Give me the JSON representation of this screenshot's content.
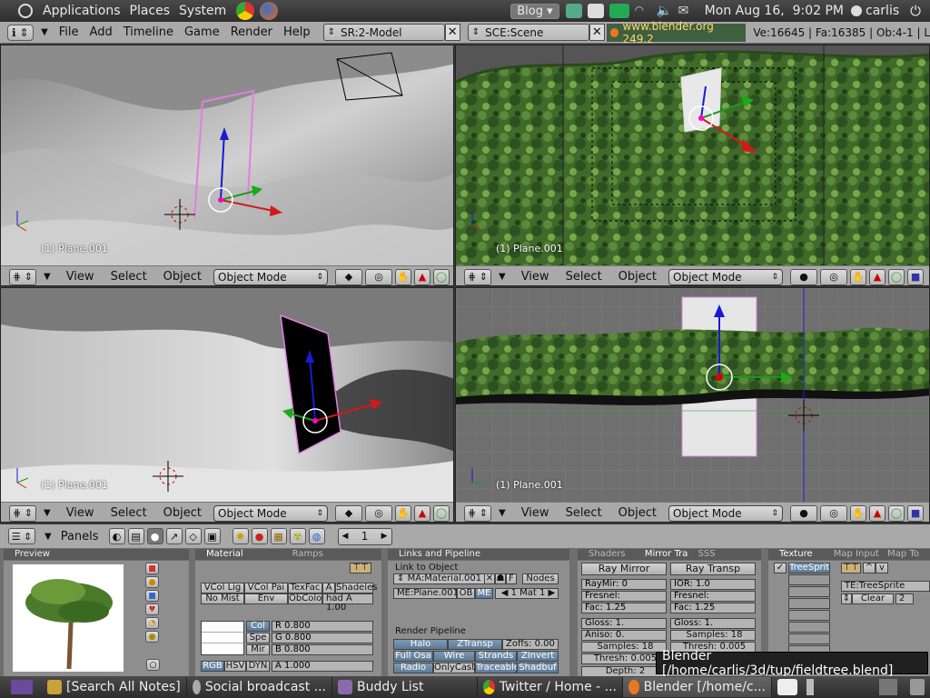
{
  "top_panel": {
    "menus": [
      "Applications",
      "Places",
      "System"
    ],
    "blog_button": "Blog",
    "datetime": "Mon Aug 16,  9:02 PM",
    "user": "carlis"
  },
  "blender_header": {
    "menus": [
      "File",
      "Add",
      "Timeline",
      "Game",
      "Render",
      "Help"
    ],
    "screen": "SR:2-Model",
    "scene": "SCE:Scene",
    "url": "www.blender.org 249.2",
    "stats": "Ve:16645 | Fa:16385 | Ob:4-1 | L"
  },
  "viewports": [
    {
      "label": "(1) Plane.001",
      "menus": [
        "View",
        "Select",
        "Object"
      ],
      "mode": "Object Mode"
    },
    {
      "label": "(1) Plane.001",
      "menus": [
        "View",
        "Select",
        "Object"
      ],
      "mode": "Object Mode"
    },
    {
      "label": "(1) Plane.001",
      "menus": [
        "View",
        "Select",
        "Object"
      ],
      "mode": "Object Mode"
    },
    {
      "label": "(1) Plane.001",
      "menus": [
        "View",
        "Select",
        "Object"
      ],
      "mode": "Object Mode"
    }
  ],
  "buttons_window": {
    "panels_label": "Panels",
    "frame": "1",
    "preview": {
      "title": "Preview"
    },
    "material": {
      "title": "Material",
      "tab2": "Ramps",
      "row1": [
        "VCol Lig",
        "VCol Pai",
        "TexFac",
        "A",
        "Shadeles"
      ],
      "row2": [
        "No Mist",
        "Env",
        "ObColo",
        "had A 1.00"
      ],
      "col_labels": [
        "Col",
        "Spe",
        "Mir"
      ],
      "rgb": [
        "R 0.800",
        "G 0.800",
        "B 0.800"
      ],
      "modes": [
        "RGB",
        "HSV",
        "DYN"
      ],
      "alpha": "A 1.000"
    },
    "links": {
      "title": "Links and Pipeline",
      "link_to_object": "Link to Object",
      "ma": "MA:Material.001",
      "f": "F",
      "nodes": "Nodes",
      "me": "ME:Plane.001",
      "ob": "OB",
      "me_btn": "ME",
      "mat": "1 Mat 1",
      "render_pipeline": "Render Pipeline",
      "pipe_row1": [
        "Halo",
        "ZTransp",
        "Zoffs: 0.00"
      ],
      "pipe_row2": [
        "Full Osa",
        "Wire",
        "Strands",
        "ZInvert"
      ],
      "pipe_row3": [
        "Radio",
        "OnlyCast",
        "Traceable",
        "Shadbuf"
      ]
    },
    "shaders": {
      "tab1": "Shaders",
      "tab2": "Mirror Tra",
      "tab3": "SSS",
      "ray_mirror": "Ray Mirror",
      "ray_transp": "Ray Transp",
      "raymir": "RayMir: 0",
      "ior": "IOR: 1.0",
      "fresnel1": "Fresnel:",
      "fresnel2": "Fresnel:",
      "fac1": "Fac: 1.25",
      "fac2": "Fac: 1.25",
      "gloss1": "Gloss: 1.",
      "gloss2": "Gloss: 1.",
      "aniso": "Aniso: 0.",
      "samples1": "Samples: 18",
      "samples2": "Samples: 18",
      "thresh1": "Thresh: 0.005",
      "thresh2": "Thresh: 0.005",
      "depth": "Depth: 2"
    },
    "texture": {
      "title": "Texture",
      "tab2": "Map Input",
      "tab3": "Map To",
      "slot": "TreeSprit",
      "te": "TE:TreeSprite",
      "clear": "Clear",
      "num": "2"
    }
  },
  "tooltip": "Blender [/home/carlis/3d/tup/fieldtree.blend]",
  "taskbar": {
    "tasks": [
      "[Search All Notes]",
      "Social broadcast ...",
      "Buddy List",
      "Twitter / Home - ...",
      "Blender [/home/c..."
    ]
  }
}
